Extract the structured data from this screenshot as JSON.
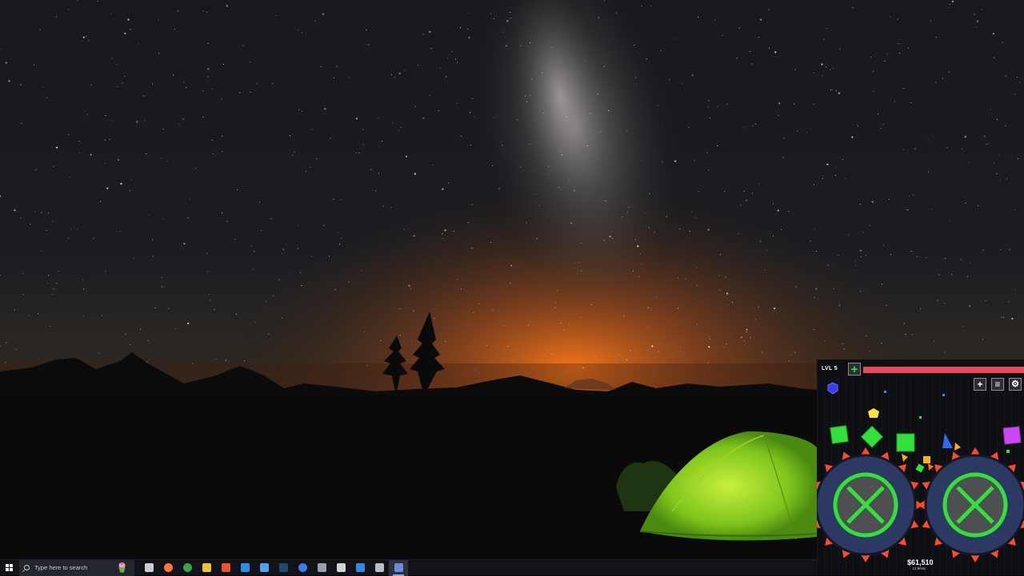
{
  "taskbar": {
    "search_placeholder": "Type here to search",
    "pinned_apps": [
      {
        "name": "task-view",
        "color": "#c9ccd2"
      },
      {
        "name": "firefox",
        "color": "#ff7a2f"
      },
      {
        "name": "chrome",
        "color": "#3fa34d"
      },
      {
        "name": "file-explorer",
        "color": "#f2c230"
      },
      {
        "name": "app-orange",
        "color": "#e8552b"
      },
      {
        "name": "mail",
        "color": "#2b8fe8"
      },
      {
        "name": "microsoft-store",
        "color": "#4aa3f0"
      },
      {
        "name": "steam",
        "color": "#1b4a73"
      },
      {
        "name": "app-blue-circle",
        "color": "#3d7cf0"
      },
      {
        "name": "app-gear",
        "color": "#9aa0a8"
      },
      {
        "name": "app-box",
        "color": "#d0d4da"
      },
      {
        "name": "vscode",
        "color": "#2f8ae0"
      },
      {
        "name": "app-cube",
        "color": "#b9bec6"
      },
      {
        "name": "game-app",
        "color": "#6c8ad8"
      }
    ]
  },
  "game": {
    "level_label": "LVL 5",
    "plus_label": "+",
    "xp_progress": 1.0,
    "add_label": "+",
    "menu_label": "≡",
    "settings_label": "⚙",
    "money": "$61,510",
    "rate": "11.9/sec"
  },
  "colors": {
    "accent_green": "#33e03a",
    "xp_red": "#e8485a",
    "saw_red": "#ff4a2a",
    "wheel_blue": "#2c3a63"
  }
}
